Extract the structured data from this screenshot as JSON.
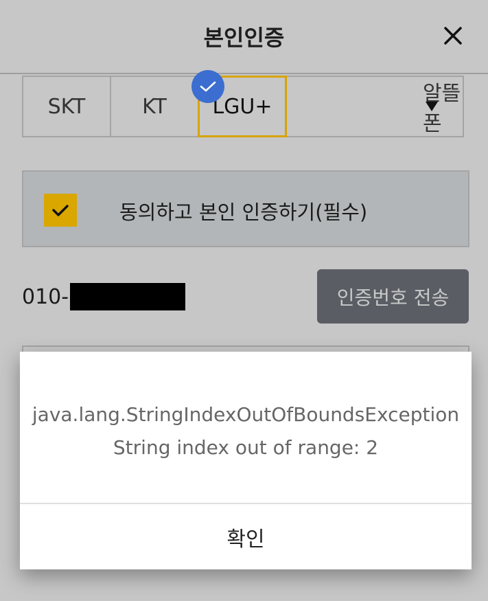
{
  "header": {
    "title": "본인인증",
    "close_icon": "close-icon"
  },
  "carriers": {
    "items": [
      "SKT",
      "KT",
      "LGU+",
      "알뜰폰"
    ],
    "selected": "LGU+",
    "selected_color": "#d7a300",
    "check_badge_color": "#3c6dd0"
  },
  "consent": {
    "label": "동의하고 본인 인증하기(필수)",
    "checked": true,
    "checkbox_color": "#d9a700"
  },
  "phone": {
    "prefix": "010-"
  },
  "send_code": {
    "label": "인증번호 전송"
  },
  "dialog": {
    "line1": "java.lang.StringIndexOutOfBoundsException",
    "line2": "String index out of range: 2",
    "ok_label": "확인"
  }
}
